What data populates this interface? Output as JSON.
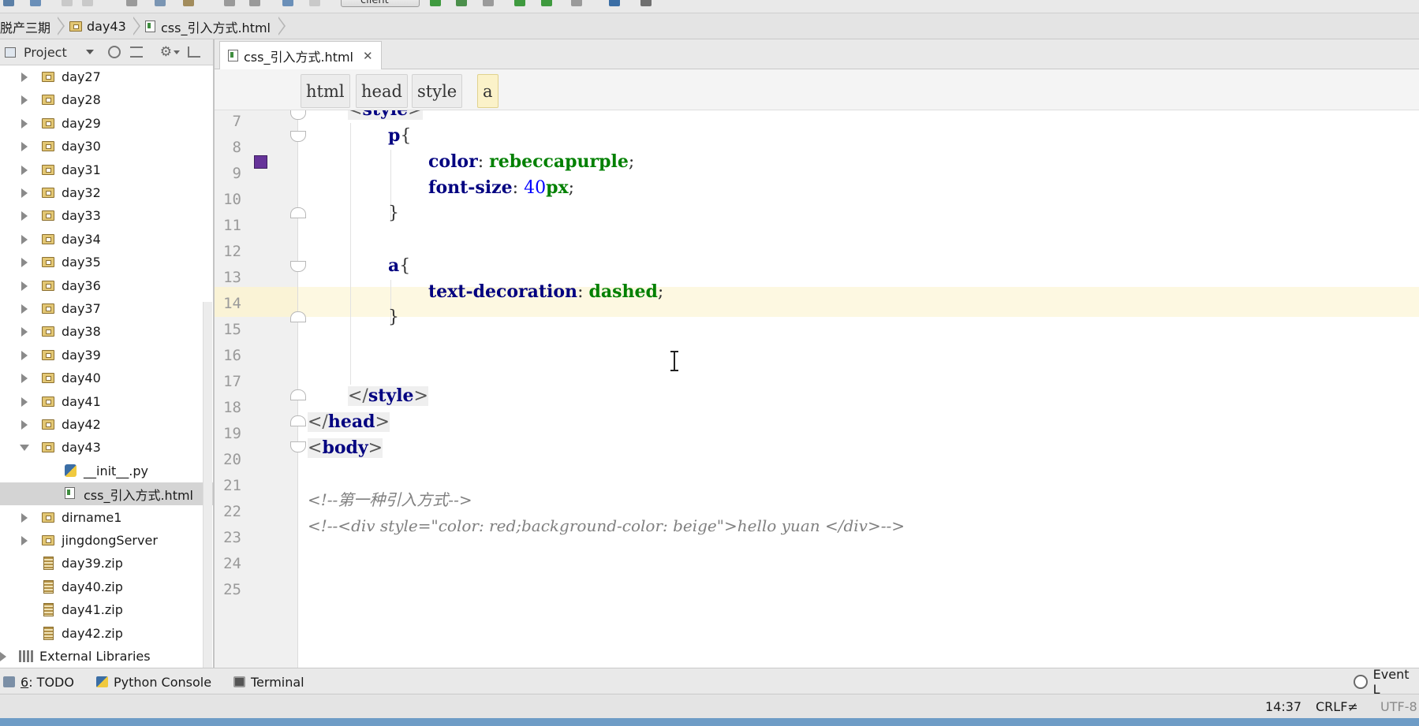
{
  "toolbar": {
    "run_config": "client"
  },
  "navbar": {
    "crumbs": [
      "脱产三期",
      "day43",
      "css_引入方式.html"
    ]
  },
  "project_panel": {
    "title": "Project",
    "items": [
      {
        "label": "day27",
        "kind": "folder",
        "expanded": false
      },
      {
        "label": "day28",
        "kind": "folder",
        "expanded": false
      },
      {
        "label": "day29",
        "kind": "folder",
        "expanded": false
      },
      {
        "label": "day30",
        "kind": "folder",
        "expanded": false
      },
      {
        "label": "day31",
        "kind": "folder",
        "expanded": false
      },
      {
        "label": "day32",
        "kind": "folder",
        "expanded": false
      },
      {
        "label": "day33",
        "kind": "folder",
        "expanded": false
      },
      {
        "label": "day34",
        "kind": "folder",
        "expanded": false
      },
      {
        "label": "day35",
        "kind": "folder",
        "expanded": false
      },
      {
        "label": "day36",
        "kind": "folder",
        "expanded": false
      },
      {
        "label": "day37",
        "kind": "folder",
        "expanded": false
      },
      {
        "label": "day38",
        "kind": "folder",
        "expanded": false
      },
      {
        "label": "day39",
        "kind": "folder",
        "expanded": false
      },
      {
        "label": "day40",
        "kind": "folder",
        "expanded": false
      },
      {
        "label": "day41",
        "kind": "folder",
        "expanded": false
      },
      {
        "label": "day42",
        "kind": "folder",
        "expanded": false
      },
      {
        "label": "day43",
        "kind": "folder",
        "expanded": true
      },
      {
        "label": "__init__.py",
        "kind": "py"
      },
      {
        "label": "css_引入方式.html",
        "kind": "html",
        "selected": true
      },
      {
        "label": "dirname1",
        "kind": "folder",
        "expanded": false
      },
      {
        "label": "jingdongServer",
        "kind": "folder",
        "expanded": false
      },
      {
        "label": "day39.zip",
        "kind": "zip"
      },
      {
        "label": "day40.zip",
        "kind": "zip"
      },
      {
        "label": "day41.zip",
        "kind": "zip"
      },
      {
        "label": "day42.zip",
        "kind": "zip"
      },
      {
        "label": "External Libraries",
        "kind": "lib",
        "expanded": false
      }
    ]
  },
  "editor": {
    "tab_label": "css_引入方式.html",
    "tag_breadcrumbs": [
      "html",
      "head",
      "style",
      "a"
    ],
    "line_numbers": [
      "7",
      "8",
      "9",
      "10",
      "11",
      "12",
      "13",
      "14",
      "15",
      "16",
      "17",
      "18",
      "19",
      "20",
      "21",
      "22",
      "23",
      "24",
      "25"
    ],
    "code": {
      "l7_tag": "style",
      "l8_sel": "p",
      "l9_prop": "color",
      "l9_val": "rebeccapurple",
      "l10_prop": "font-size",
      "l10_num": "40",
      "l10_unit": "px",
      "l13_sel": "a",
      "l14_prop": "text-decoration",
      "l14_val": "dashed",
      "l18_tag": "style",
      "l19_tag": "head",
      "l20_tag": "body",
      "l22_comment": "<!--第一种引入方式-->",
      "l23_comment": "<!--<div style=\"color: red;background-color: beige\">hello yuan </div>-->"
    },
    "color_swatch": "#663399",
    "current_line": "14"
  },
  "browser_icons": [
    "chrome-icon",
    "firefox-icon",
    "safari-icon",
    "opera-icon",
    "ie-icon"
  ],
  "toolwindows": {
    "todo_num": "6",
    "todo_label": ": TODO",
    "python_console": "Python Console",
    "terminal": "Terminal",
    "event_log": "Event L"
  },
  "status": {
    "position": "14:37",
    "line_sep": "CRLF≠",
    "encoding": "UTF-8"
  }
}
